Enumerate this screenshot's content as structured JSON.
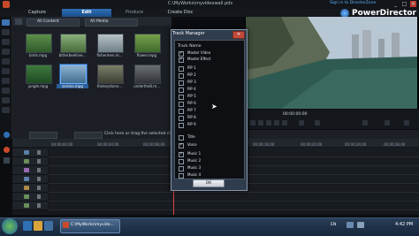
{
  "window": {
    "title": "C:\\MyWorks\\myvideowall.pds",
    "sign_in": "Sign in to DirectorZone",
    "brand": "PowerDirector",
    "controls": {
      "minimize": "_",
      "maximize": "□",
      "close": "✕"
    }
  },
  "modes": {
    "capture": "Capture",
    "edit": "Edit",
    "produce": "Produce",
    "create_disc": "Create Disc"
  },
  "library": {
    "filter_left": "All Content",
    "filter_right": "All Media",
    "items": [
      {
        "label": "birds.mpg"
      },
      {
        "label": "bitterbeehive..."
      },
      {
        "label": "fishermen.m..."
      },
      {
        "label": "flower.mpg"
      },
      {
        "label": "jungle.mpg"
      },
      {
        "label": "serene.mpg"
      },
      {
        "label": "thekeystone..."
      },
      {
        "label": "underthe8.m..."
      }
    ]
  },
  "preview": {
    "timecode": "00:00:00:00"
  },
  "timeline": {
    "hint": "Click here or drag the selected clip to the...",
    "ruler": [
      "00;00;00;00",
      "00;00;04;00",
      "00;00;08;00",
      "00;00;12;00",
      "00;00;16;00",
      "00;00;20;00",
      "00;00;24;00",
      "00;00;28;00"
    ]
  },
  "track_manager": {
    "title": "Track Manager",
    "close": "✕",
    "header": "Track Name",
    "tracks": [
      {
        "name": "Master Video",
        "checked": true
      },
      {
        "name": "Master Effect",
        "checked": true
      },
      {
        "name": "PiP 1",
        "checked": false
      },
      {
        "name": "PiP 2",
        "checked": false
      },
      {
        "name": "PiP 3",
        "checked": false
      },
      {
        "name": "PiP 4",
        "checked": false
      },
      {
        "name": "PiP 5",
        "checked": false
      },
      {
        "name": "PiP 6",
        "checked": false
      },
      {
        "name": "PiP 7",
        "checked": false
      },
      {
        "name": "PiP 8",
        "checked": false
      },
      {
        "name": "PiP 9",
        "checked": false
      },
      {
        "name": "Title",
        "checked": false
      },
      {
        "name": "Voice",
        "checked": true
      },
      {
        "name": "Music 1",
        "checked": true
      },
      {
        "name": "Music 2",
        "checked": false
      },
      {
        "name": "Music 3",
        "checked": false
      },
      {
        "name": "Music 4",
        "checked": false
      }
    ],
    "ok": "OK"
  },
  "taskbar": {
    "task": "C:\\MyWorks\\myvide...",
    "lang": "EN",
    "time": "4:42 PM"
  },
  "colors": {
    "accent": "#2f6fb5",
    "dialog_frame": "#2e3c4d",
    "close_red": "#c14a3b"
  }
}
